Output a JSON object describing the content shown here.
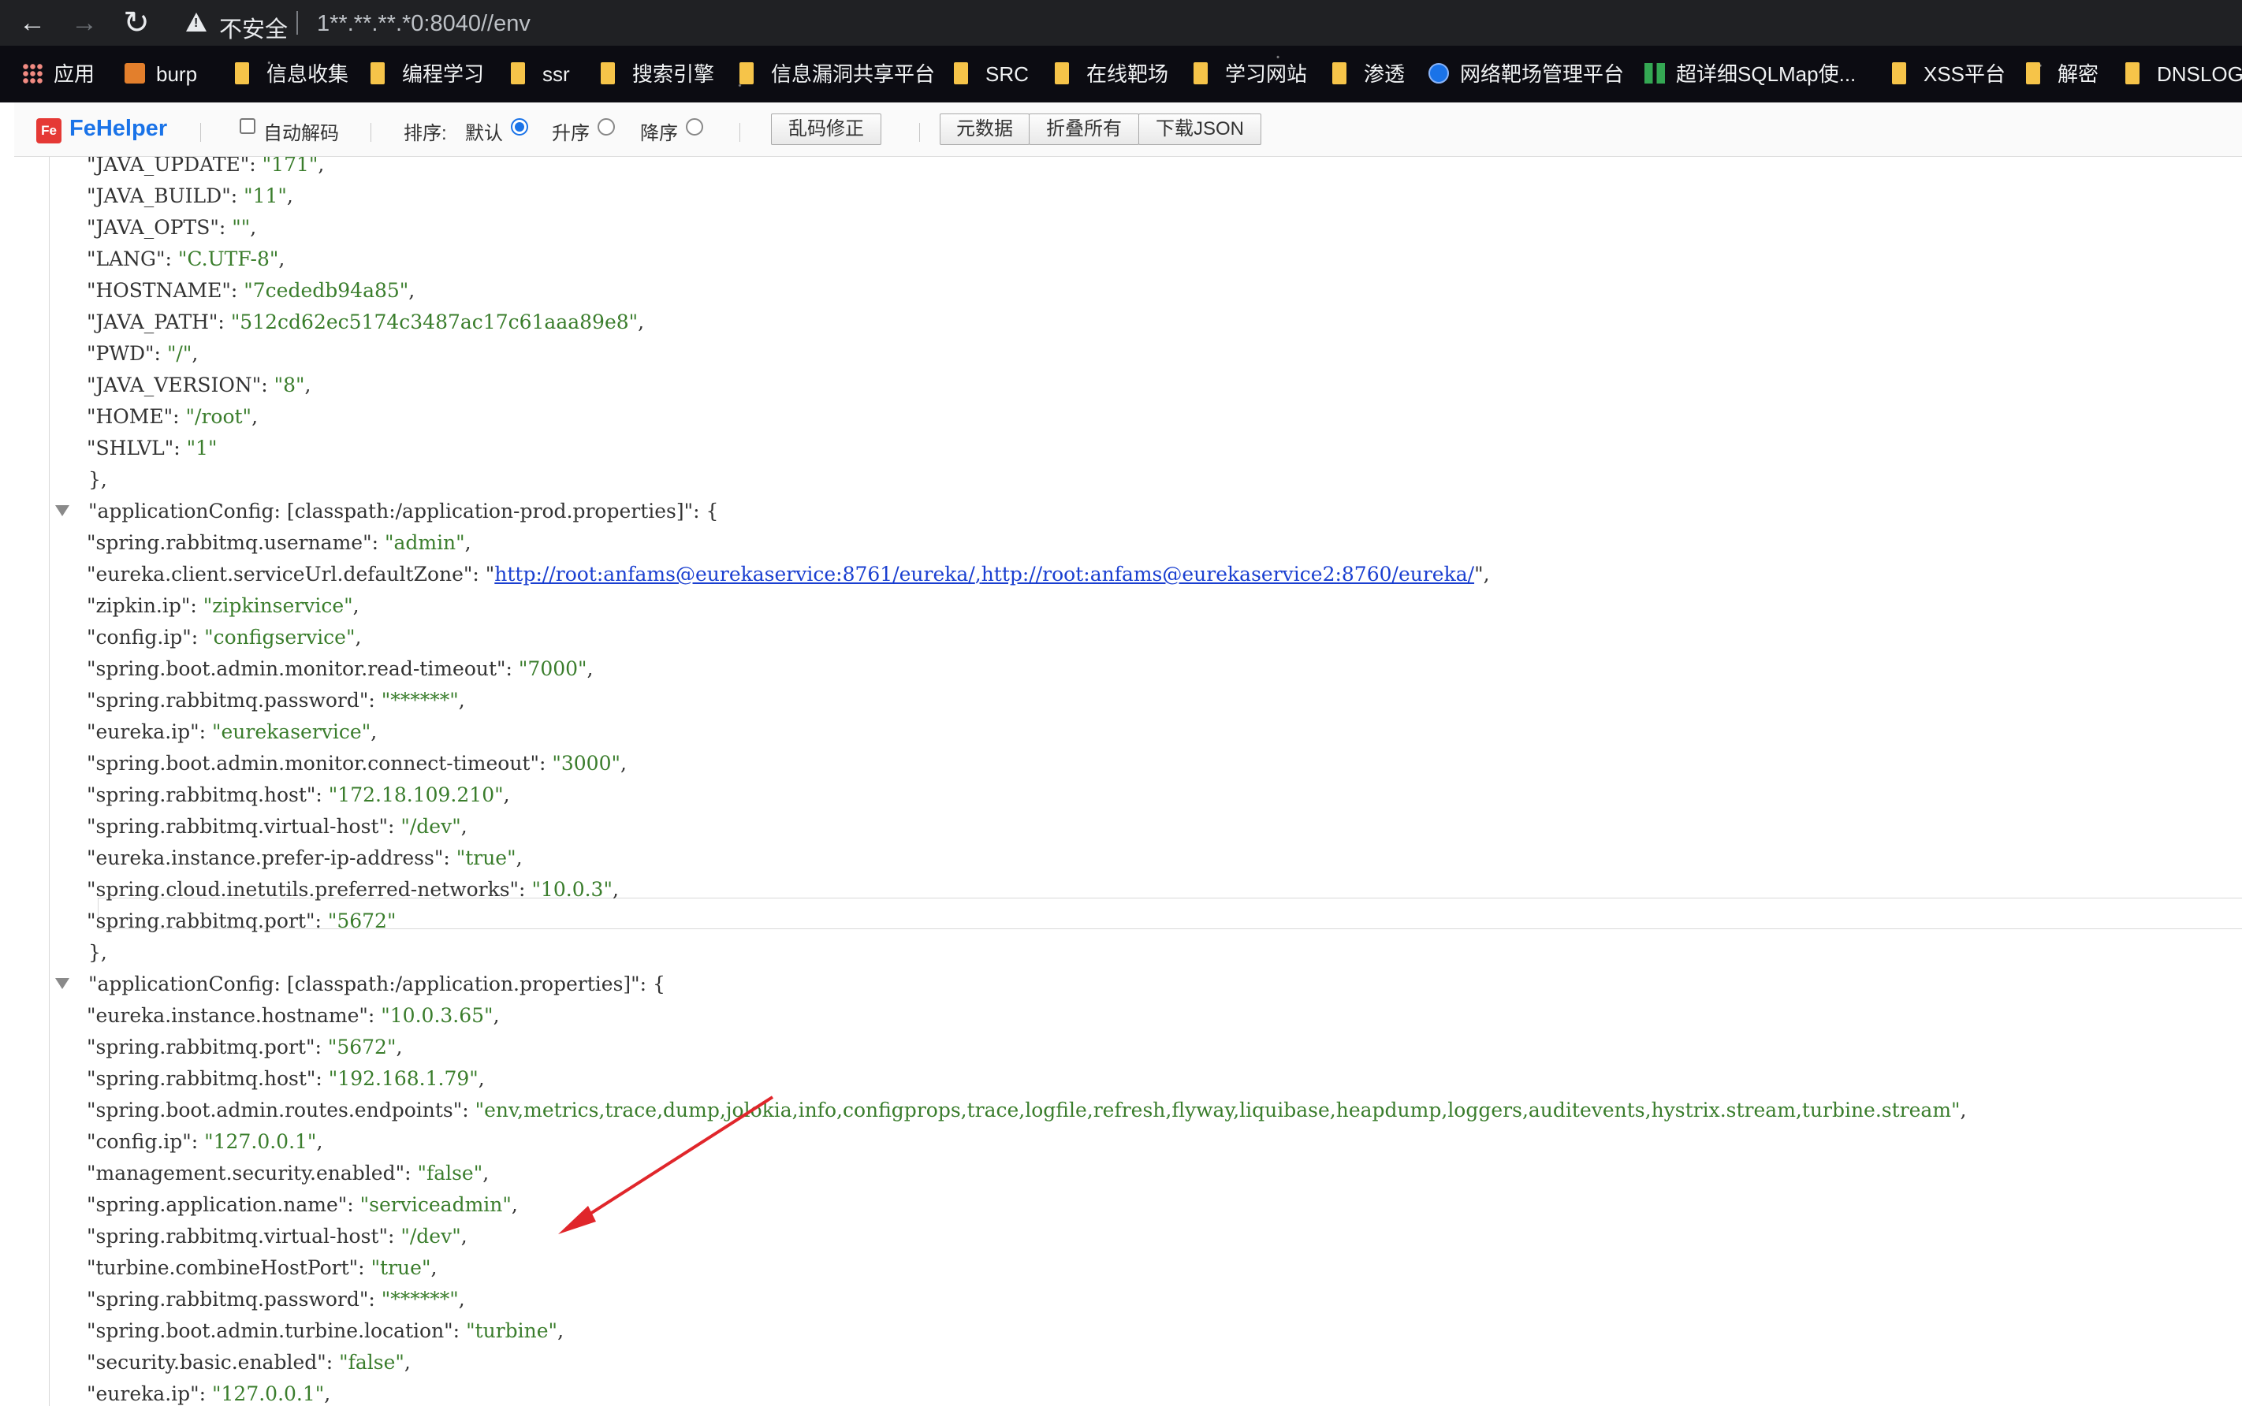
{
  "browser": {
    "security_label": "不安全",
    "url": "1**.**.**.*0:8040//env"
  },
  "bookmarks": [
    {
      "label": "应用",
      "icon": "apps-grid-icon"
    },
    {
      "label": "burp",
      "icon": "burp-icon"
    },
    {
      "label": "信息收集",
      "icon": "folder-icon"
    },
    {
      "label": "编程学习",
      "icon": "folder-icon"
    },
    {
      "label": "ssr",
      "icon": "folder-icon"
    },
    {
      "label": "搜索引擎",
      "icon": "folder-icon"
    },
    {
      "label": "信息漏洞共享平台",
      "icon": "folder-icon"
    },
    {
      "label": "SRC",
      "icon": "folder-icon"
    },
    {
      "label": "在线靶场",
      "icon": "folder-icon"
    },
    {
      "label": "学习网站",
      "icon": "folder-icon"
    },
    {
      "label": "渗透",
      "icon": "folder-icon"
    },
    {
      "label": "网络靶场管理平台",
      "icon": "globe-icon"
    },
    {
      "label": "超详细SQLMap使...",
      "icon": "sqlmap-icon"
    },
    {
      "label": "XSS平台",
      "icon": "folder-icon"
    },
    {
      "label": "解密",
      "icon": "folder-icon"
    },
    {
      "label": "DNSLOG",
      "icon": "folder-icon"
    }
  ],
  "toolbar": {
    "logo": "FeHelper",
    "auto_decode": "自动解码",
    "sort_label": "排序:",
    "sort_default": "默认",
    "sort_asc": "升序",
    "sort_desc": "降序",
    "fix_garbled": "乱码修正",
    "metadata": "元数据",
    "collapse_all": "折叠所有",
    "download_json": "下载JSON"
  },
  "json": {
    "env_rest": [
      {
        "key": "\"JAVA_UPDATE\":",
        "value": "\"171\"",
        "tail": ","
      },
      {
        "key": "\"JAVA_BUILD\":",
        "value": "\"11\"",
        "tail": ","
      },
      {
        "key": "\"JAVA_OPTS\":",
        "value": "\"\"",
        "tail": ","
      },
      {
        "key": "\"LANG\":",
        "value": "\"C.UTF-8\"",
        "tail": ","
      },
      {
        "key": "\"HOSTNAME\":",
        "value": "\"7cededb94a85\"",
        "tail": ","
      },
      {
        "key": "\"JAVA_PATH\":",
        "value": "\"512cd62ec5174c3487ac17c61aaa89e8\"",
        "tail": ","
      },
      {
        "key": "\"PWD\":",
        "value": "\"/\"",
        "tail": ","
      },
      {
        "key": "\"JAVA_VERSION\":",
        "value": "\"8\"",
        "tail": ","
      },
      {
        "key": "\"HOME\":",
        "value": "\"/root\"",
        "tail": ","
      },
      {
        "key": "\"SHLVL\":",
        "value": "\"1\"",
        "tail": ""
      }
    ],
    "close1": "},",
    "group_prod": "\"applicationConfig: [classpath:/application-prod.properties]\":  {",
    "prod": {
      "username_key": "\"spring.rabbitmq.username\":",
      "username_val": "\"admin\"",
      "eureka_zone_key": "\"eureka.client.serviceUrl.defaultZone\":",
      "eureka_zone_quote_open": "\"",
      "eureka_zone_link1": "http://root:anfams@eurekaservice:8761/eureka/",
      "eureka_zone_link_sep": ",",
      "eureka_zone_link2": "http://root:anfams@eurekaservice2:8760/eureka/",
      "eureka_zone_quote_close": "\"",
      "rest": [
        {
          "key": "\"zipkin.ip\":",
          "value": "\"zipkinservice\"",
          "tail": ","
        },
        {
          "key": "\"config.ip\":",
          "value": "\"configservice\"",
          "tail": ","
        },
        {
          "key": "\"spring.boot.admin.monitor.read-timeout\":",
          "value": "\"7000\"",
          "tail": ","
        },
        {
          "key": "\"spring.rabbitmq.password\":",
          "value": "\"******\"",
          "tail": ","
        },
        {
          "key": "\"eureka.ip\":",
          "value": "\"eurekaservice\"",
          "tail": ","
        },
        {
          "key": "\"spring.boot.admin.monitor.connect-timeout\":",
          "value": "\"3000\"",
          "tail": ","
        },
        {
          "key": "\"spring.rabbitmq.host\":",
          "value": "\"172.18.109.210\"",
          "tail": ","
        },
        {
          "key": "\"spring.rabbitmq.virtual-host\":",
          "value": "\"/dev\"",
          "tail": ","
        },
        {
          "key": "\"eureka.instance.prefer-ip-address\":",
          "value": "\"true\"",
          "tail": ","
        },
        {
          "key": "\"spring.cloud.inetutils.preferred-networks\":",
          "value": "\"10.0.3\"",
          "tail": ","
        },
        {
          "key": "\"spring.rabbitmq.port\":",
          "value": "\"5672\"",
          "tail": ""
        }
      ]
    },
    "close2": "},",
    "group_app": "\"applicationConfig: [classpath:/application.properties]\":  {",
    "app": [
      {
        "key": "\"eureka.instance.hostname\":",
        "value": "\"10.0.3.65\"",
        "tail": ","
      },
      {
        "key": "\"spring.rabbitmq.port\":",
        "value": "\"5672\"",
        "tail": ","
      },
      {
        "key": "\"spring.rabbitmq.host\":",
        "value": "\"192.168.1.79\"",
        "tail": ","
      },
      {
        "key": "\"spring.boot.admin.routes.endpoints\":",
        "value": "\"env,metrics,trace,dump,jolokia,info,configprops,trace,logfile,refresh,flyway,liquibase,heapdump,loggers,auditevents,hystrix.stream,turbine.stream\"",
        "tail": ","
      },
      {
        "key": "\"config.ip\":",
        "value": "\"127.0.0.1\"",
        "tail": ","
      },
      {
        "key": "\"management.security.enabled\":",
        "value": "\"false\"",
        "tail": ","
      },
      {
        "key": "\"spring.application.name\":",
        "value": "\"serviceadmin\"",
        "tail": ","
      },
      {
        "key": "\"spring.rabbitmq.virtual-host\":",
        "value": "\"/dev\"",
        "tail": ","
      },
      {
        "key": "\"turbine.combineHostPort\":",
        "value": "\"true\"",
        "tail": ","
      },
      {
        "key": "\"spring.rabbitmq.password\":",
        "value": "\"******\"",
        "tail": ","
      },
      {
        "key": "\"spring.boot.admin.turbine.location\":",
        "value": "\"turbine\"",
        "tail": ","
      },
      {
        "key": "\"security.basic.enabled\":",
        "value": "\"false\"",
        "tail": ","
      },
      {
        "key": "\"eureka.ip\":",
        "value": "\"127.0.0.1\"",
        "tail": ","
      }
    ]
  },
  "annotation_arrow_color": "#e0262b"
}
